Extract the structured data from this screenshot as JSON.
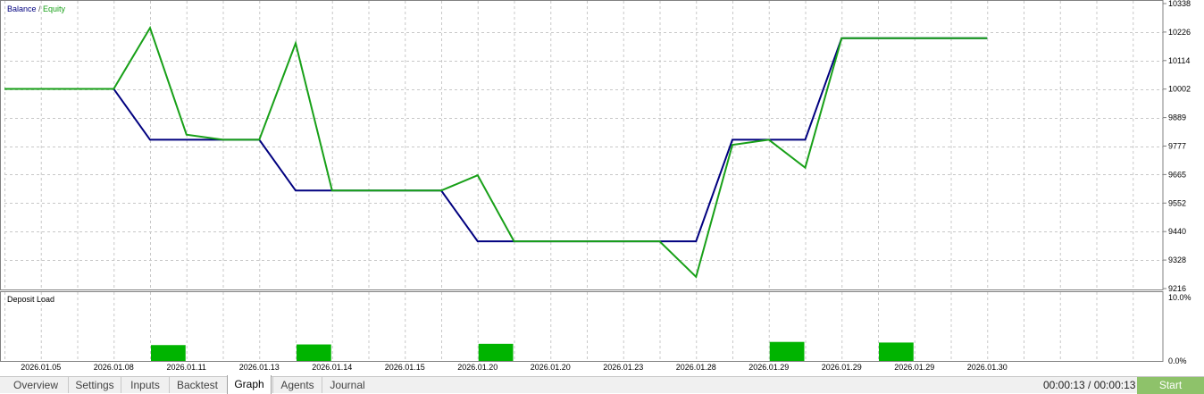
{
  "chart_data": [
    {
      "type": "line",
      "legend": {
        "balance": "Balance",
        "separator": " / ",
        "equity": "Equity",
        "placement": "top-left"
      },
      "colors": {
        "balance": "#00007f",
        "equity": "#18a018",
        "grid": "#c8c8c8"
      },
      "y_ticks": [
        "10338",
        "10226",
        "10114",
        "10002",
        "9889",
        "9777",
        "9665",
        "9552",
        "9440",
        "9328",
        "9216"
      ],
      "ylim": [
        9216,
        10338
      ],
      "grid": true,
      "x_labels": [
        "2026.01.05",
        "2026.01.08",
        "2026.01.11",
        "2026.01.13",
        "2026.01.14",
        "2026.01.15",
        "2026.01.20",
        "2026.01.20",
        "2026.01.23",
        "2026.01.28",
        "2026.01.29",
        "2026.01.29",
        "2026.01.29",
        "2026.01.30"
      ],
      "x": [
        0,
        1,
        2,
        3,
        4,
        5,
        6,
        7,
        8,
        9,
        10,
        11,
        12,
        13,
        14,
        15,
        16,
        17,
        18,
        19,
        20,
        21,
        22,
        23,
        24,
        25,
        26,
        27
      ],
      "series": [
        {
          "name": "Balance",
          "values": [
            10002,
            10002,
            10002,
            10002,
            9802,
            9802,
            9802,
            9802,
            9602,
            9602,
            9602,
            9602,
            9602,
            9402,
            9402,
            9402,
            9402,
            9402,
            9402,
            9402,
            9802,
            9802,
            9802,
            10202,
            10202,
            10202,
            10202,
            10202
          ]
        },
        {
          "name": "Equity",
          "values": [
            10002,
            10002,
            10002,
            10002,
            10242,
            9822,
            9802,
            9802,
            10182,
            9602,
            9602,
            9602,
            9602,
            9662,
            9402,
            9402,
            9402,
            9402,
            9402,
            9262,
            9782,
            9802,
            9692,
            10202,
            10202,
            10202,
            10202,
            10202
          ]
        }
      ]
    },
    {
      "type": "bar",
      "title": "Deposit Load",
      "y_ticks": [
        "10.0%",
        "0.0%"
      ],
      "ylim": [
        0,
        10
      ],
      "color": "#00b400",
      "bars": [
        {
          "x": 4,
          "value": 2.5
        },
        {
          "x": 8,
          "value": 2.6
        },
        {
          "x": 13,
          "value": 2.7
        },
        {
          "x": 21,
          "value": 3.0
        },
        {
          "x": 24,
          "value": 2.9
        }
      ]
    }
  ],
  "tabs": [
    "Overview",
    "Settings",
    "Inputs",
    "Backtest",
    "Graph",
    "Agents",
    "Journal"
  ],
  "active_tab": "Graph",
  "timer": "00:00:13 / 00:00:13",
  "start_label": "Start"
}
